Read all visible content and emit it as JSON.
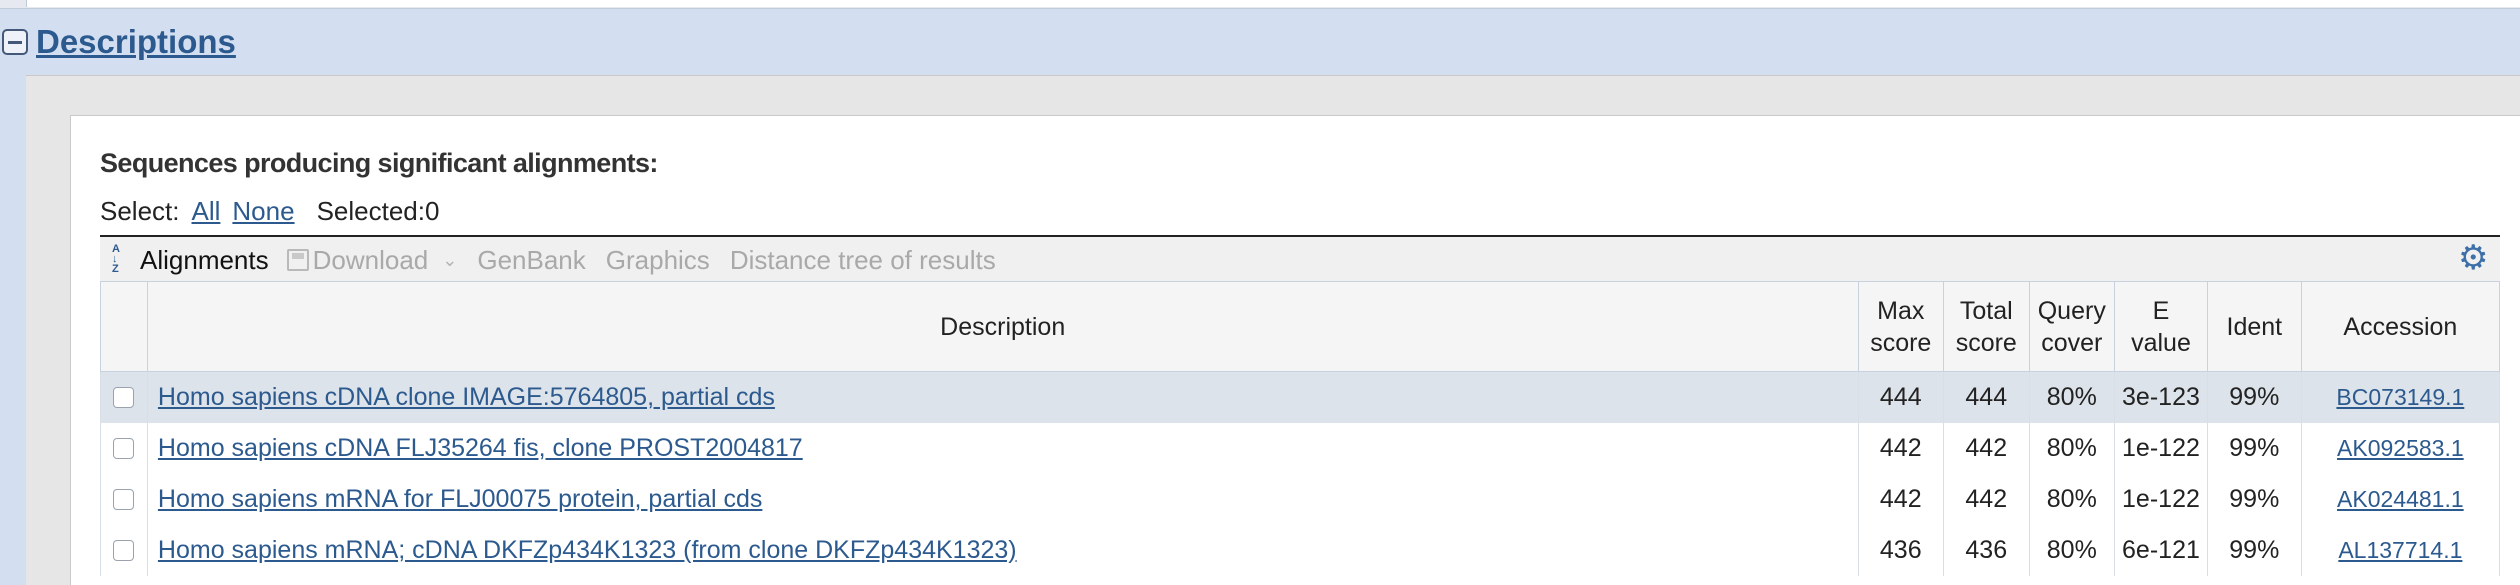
{
  "section": {
    "title": "Descriptions"
  },
  "results": {
    "heading": "Sequences producing significant alignments:",
    "select_label": "Select:",
    "select_all": "All",
    "select_none": "None",
    "selected_label": "Selected:0"
  },
  "toolbar": {
    "alignments": "Alignments",
    "download": "Download",
    "genbank": "GenBank",
    "graphics": "Graphics",
    "distance_tree": "Distance tree of results"
  },
  "table": {
    "headers": {
      "description": "Description",
      "max_score_1": "Max",
      "max_score_2": "score",
      "total_score_1": "Total",
      "total_score_2": "score",
      "query_cover_1": "Query",
      "query_cover_2": "cover",
      "e_value_1": "E",
      "e_value_2": "value",
      "ident": "Ident",
      "accession": "Accession"
    },
    "rows": [
      {
        "description": "Homo sapiens cDNA clone IMAGE:5764805, partial cds",
        "max_score": "444",
        "total_score": "444",
        "query_cover": "80%",
        "e_value": "3e-123",
        "ident": "99%",
        "accession": "BC073149.1"
      },
      {
        "description": "Homo sapiens cDNA FLJ35264 fis, clone PROST2004817",
        "max_score": "442",
        "total_score": "442",
        "query_cover": "80%",
        "e_value": "1e-122",
        "ident": "99%",
        "accession": "AK092583.1"
      },
      {
        "description": "Homo sapiens mRNA for FLJ00075 protein, partial cds",
        "max_score": "442",
        "total_score": "442",
        "query_cover": "80%",
        "e_value": "1e-122",
        "ident": "99%",
        "accession": "AK024481.1"
      },
      {
        "description": "Homo sapiens mRNA; cDNA DKFZp434K1323 (from clone DKFZp434K1323)",
        "max_score": "436",
        "total_score": "436",
        "query_cover": "80%",
        "e_value": "6e-121",
        "ident": "99%",
        "accession": "AL137714.1"
      }
    ]
  },
  "icons": {
    "collapse": "minus-box-icon",
    "sort": "sort-icon",
    "download": "disk-icon",
    "settings": "gear-icon"
  },
  "colors": {
    "link": "#2c5a8e",
    "header_band": "#d3dff0",
    "highlight_row": "#dde3ea"
  }
}
